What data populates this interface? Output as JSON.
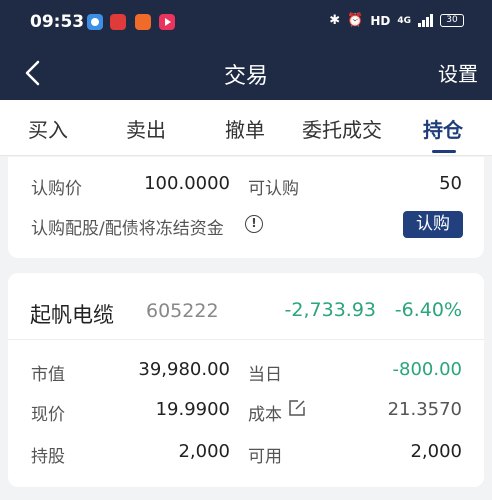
{
  "status_bar": {
    "time": "09:53",
    "network_label": "HD",
    "network_gen": "4G",
    "battery": "30"
  },
  "navbar": {
    "title": "交易",
    "settings_label": "设置"
  },
  "tabs": [
    "买入",
    "卖出",
    "撤单",
    "委托成交",
    "持仓"
  ],
  "active_tab": "持仓",
  "subscription": {
    "price_label": "认购价",
    "price_value": "100.0000",
    "available_label": "可认购",
    "available_value": "50",
    "notice": "认购配股/配债将冻结资金",
    "button_label": "认购"
  },
  "position": {
    "name": "起帆电缆",
    "code": "605222",
    "pnl": "-2,733.93",
    "pnl_pct": "-6.40%",
    "market_value_label": "市值",
    "market_value": "39,980.00",
    "today_label": "当日",
    "today_value": "-800.00",
    "price_label": "现价",
    "price": "19.9900",
    "cost_label": "成本",
    "cost": "21.3570",
    "holding_label": "持股",
    "holding": "2,000",
    "usable_label": "可用",
    "usable": "2,000"
  },
  "colors": {
    "header_bg": "#1f2a44",
    "accent": "#1f3d7a",
    "button_bg": "#22407e",
    "loss_green": "#2aa67a"
  }
}
